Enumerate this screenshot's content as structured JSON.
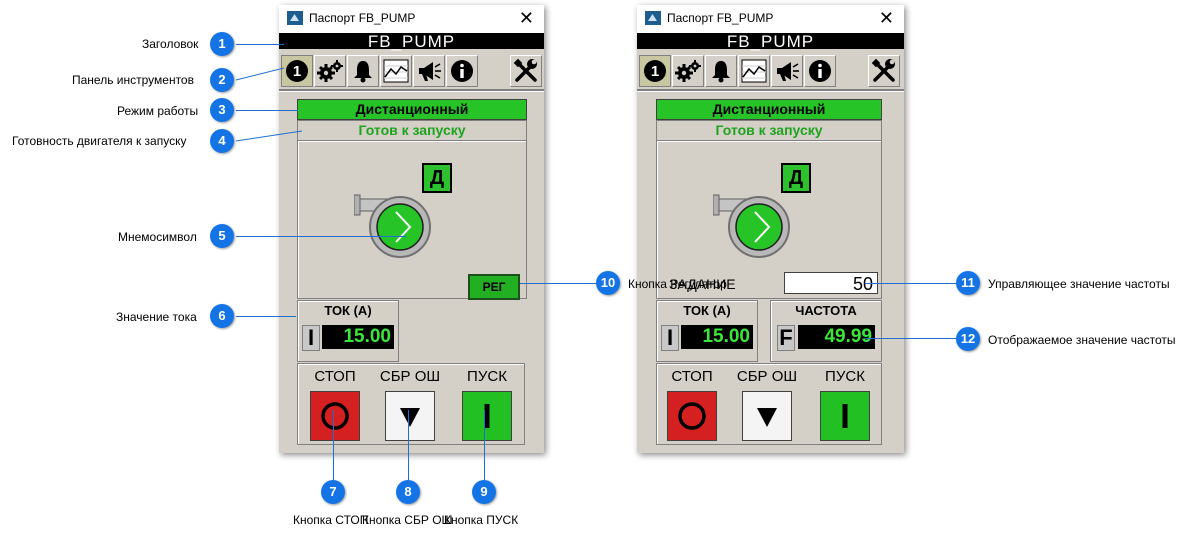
{
  "window_title": "Паспорт FB_PUMP",
  "header_title": "FB_PUMP",
  "toolbar": {
    "info_number": "1"
  },
  "mode": "Дистанционный",
  "readiness": "Готов к запуску",
  "d_indicator": "Д",
  "reg_button": "РЕГ",
  "setpoint": {
    "label": "ЗАДАНИЕ",
    "value": "50"
  },
  "current": {
    "title": "ТОК (А)",
    "letter": "I",
    "value": "15.00"
  },
  "frequency": {
    "title": "ЧАСТОТА",
    "letter": "F",
    "value": "49.99"
  },
  "commands": {
    "stop": "СТОП",
    "reset": "СБР ОШ",
    "start": "ПУСК"
  },
  "callouts": {
    "c1": {
      "num": "1",
      "label": "Заголовок"
    },
    "c2": {
      "num": "2",
      "label": "Панель инструментов"
    },
    "c3": {
      "num": "3",
      "label": "Режим работы"
    },
    "c4": {
      "num": "4",
      "label": "Готовность двигателя к запуску"
    },
    "c5": {
      "num": "5",
      "label": "Мнемосимвол"
    },
    "c6": {
      "num": "6",
      "label": "Значение тока"
    },
    "c7": {
      "num": "7",
      "label": "Кнопка СТОП"
    },
    "c8": {
      "num": "8",
      "label": "Кнопка СБР ОШ"
    },
    "c9": {
      "num": "9",
      "label": "Кнопка ПУСК"
    },
    "c10": {
      "num": "10",
      "label": "Кнопка Регулятор"
    },
    "c11": {
      "num": "11",
      "label": "Управляющее значение частоты"
    },
    "c12": {
      "num": "12",
      "label": "Отображаемое значение частоты"
    }
  },
  "colors": {
    "callout": "#1474e6",
    "green": "#27c427",
    "stop_red": "#d42020",
    "start_green": "#22c022"
  }
}
